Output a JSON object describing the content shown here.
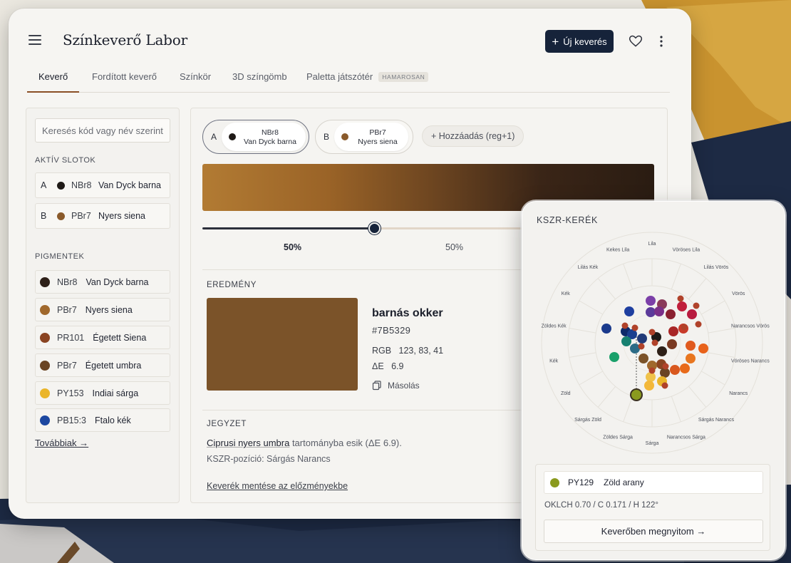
{
  "app": {
    "title": "Színkeverő Labor",
    "new_button": "Új keverés"
  },
  "tabs": [
    {
      "label": "Keverő",
      "active": true
    },
    {
      "label": "Fordított keverő"
    },
    {
      "label": "Színkör"
    },
    {
      "label": "3D színgömb"
    },
    {
      "label": "Paletta játszótér",
      "badge": "HAMAROSAN"
    }
  ],
  "sidebar": {
    "search_placeholder": "Keresés kód vagy név szerint...",
    "slots_label": "AKTÍV SLOTOK",
    "slots": [
      {
        "letter": "A",
        "code": "NBr8",
        "name": "Van Dyck barna",
        "color": "#1f1a17"
      },
      {
        "letter": "B",
        "code": "PBr7",
        "name": "Nyers siena",
        "color": "#8a5a2b"
      }
    ],
    "pigments_label": "PIGMENTEK",
    "pigments": [
      {
        "code": "NBr8",
        "name": "Van Dyck barna",
        "color": "#2e2018"
      },
      {
        "code": "PBr7",
        "name": "Nyers siena",
        "color": "#a0682c"
      },
      {
        "code": "PR101",
        "name": "Égetett Siena",
        "color": "#8a4422"
      },
      {
        "code": "PBr7",
        "name": "Égetett umbra",
        "color": "#6a4423"
      },
      {
        "code": "PY153",
        "name": "Indiai sárga",
        "color": "#eab52a"
      },
      {
        "code": "PB15:3",
        "name": "Ftalo kék",
        "color": "#1c47a0"
      }
    ],
    "more_link": "Továbbiak →"
  },
  "mixer": {
    "chips": [
      {
        "letter": "A",
        "code": "NBr8",
        "name": "Van Dyck barna",
        "color": "#1f1a17",
        "selected": true
      },
      {
        "letter": "B",
        "code": "PBr7",
        "name": "Nyers siena",
        "color": "#8a5a2b"
      }
    ],
    "add_label": "+ Hozzáadás (reg+1)",
    "ratio_a": "50%",
    "ratio_b": "50%",
    "ratio_value": 0.5
  },
  "result": {
    "label": "EREDMÉNY",
    "name": "barnás okker",
    "hex": "#7B5329",
    "rgb_label": "RGB",
    "rgb": "123, 83, 41",
    "de_label": "ΔE",
    "de": "6.9",
    "copy_label": "Másolás"
  },
  "note": {
    "label": "JEGYZET",
    "link": "Ciprusi nyers umbra",
    "line1_rest": " tartományba esik (ΔE 6.9).",
    "line2": "KSZR-pozíció: Sárgás Narancs",
    "save_link": "Keverék mentése az előzményekbe"
  },
  "wheel": {
    "title": "KSZR-KERÉK",
    "hue_labels": [
      "Lila",
      "Vöröses Lila",
      "Lilás Vörös",
      "Vörös",
      "Narancsos Vörös",
      "Vöröses Narancs",
      "Narancs",
      "Sárgás Narancs",
      "Narancsos Sárga",
      "Sárga",
      "Zöldes Sárga",
      "Sárgás Zöld",
      "Zöld",
      "Kék",
      "Zöldes Kék",
      "Kék",
      "Lilás Kék",
      "Kekes Lila"
    ],
    "selected": {
      "code": "PY129",
      "name": "Zöld arany",
      "color": "#8a9a1e"
    },
    "oklch": "OKLCH 0.70 / C 0.171 / H 122°",
    "open_button": "Keverőben megnyitom →"
  },
  "colors": {
    "accent": "#16233a",
    "result": "#7b5329"
  }
}
